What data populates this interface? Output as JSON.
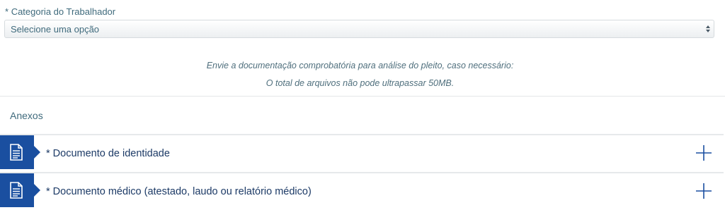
{
  "form": {
    "category_label_required": "*",
    "category_label": "Categoria do Trabalhador",
    "category_select_value": "Selecione uma opção"
  },
  "info": {
    "line1": "Envie a documentação comprobatória para análise do pleito, caso necessário:",
    "line2": "O total de arquivos não pode ultrapassar 50MB."
  },
  "attachments": {
    "title": "Anexos",
    "items": [
      {
        "label": "* Documento de identidade",
        "icon": "document-icon",
        "action_icon": "plus-icon"
      },
      {
        "label": "* Documento médico (atestado, laudo ou relatório médico)",
        "icon": "document-icon",
        "action_icon": "plus-icon"
      }
    ]
  },
  "colors": {
    "accent_blue": "#1a4fa0",
    "label_text": "#3f6a7c",
    "row_text": "#1c3a66"
  }
}
